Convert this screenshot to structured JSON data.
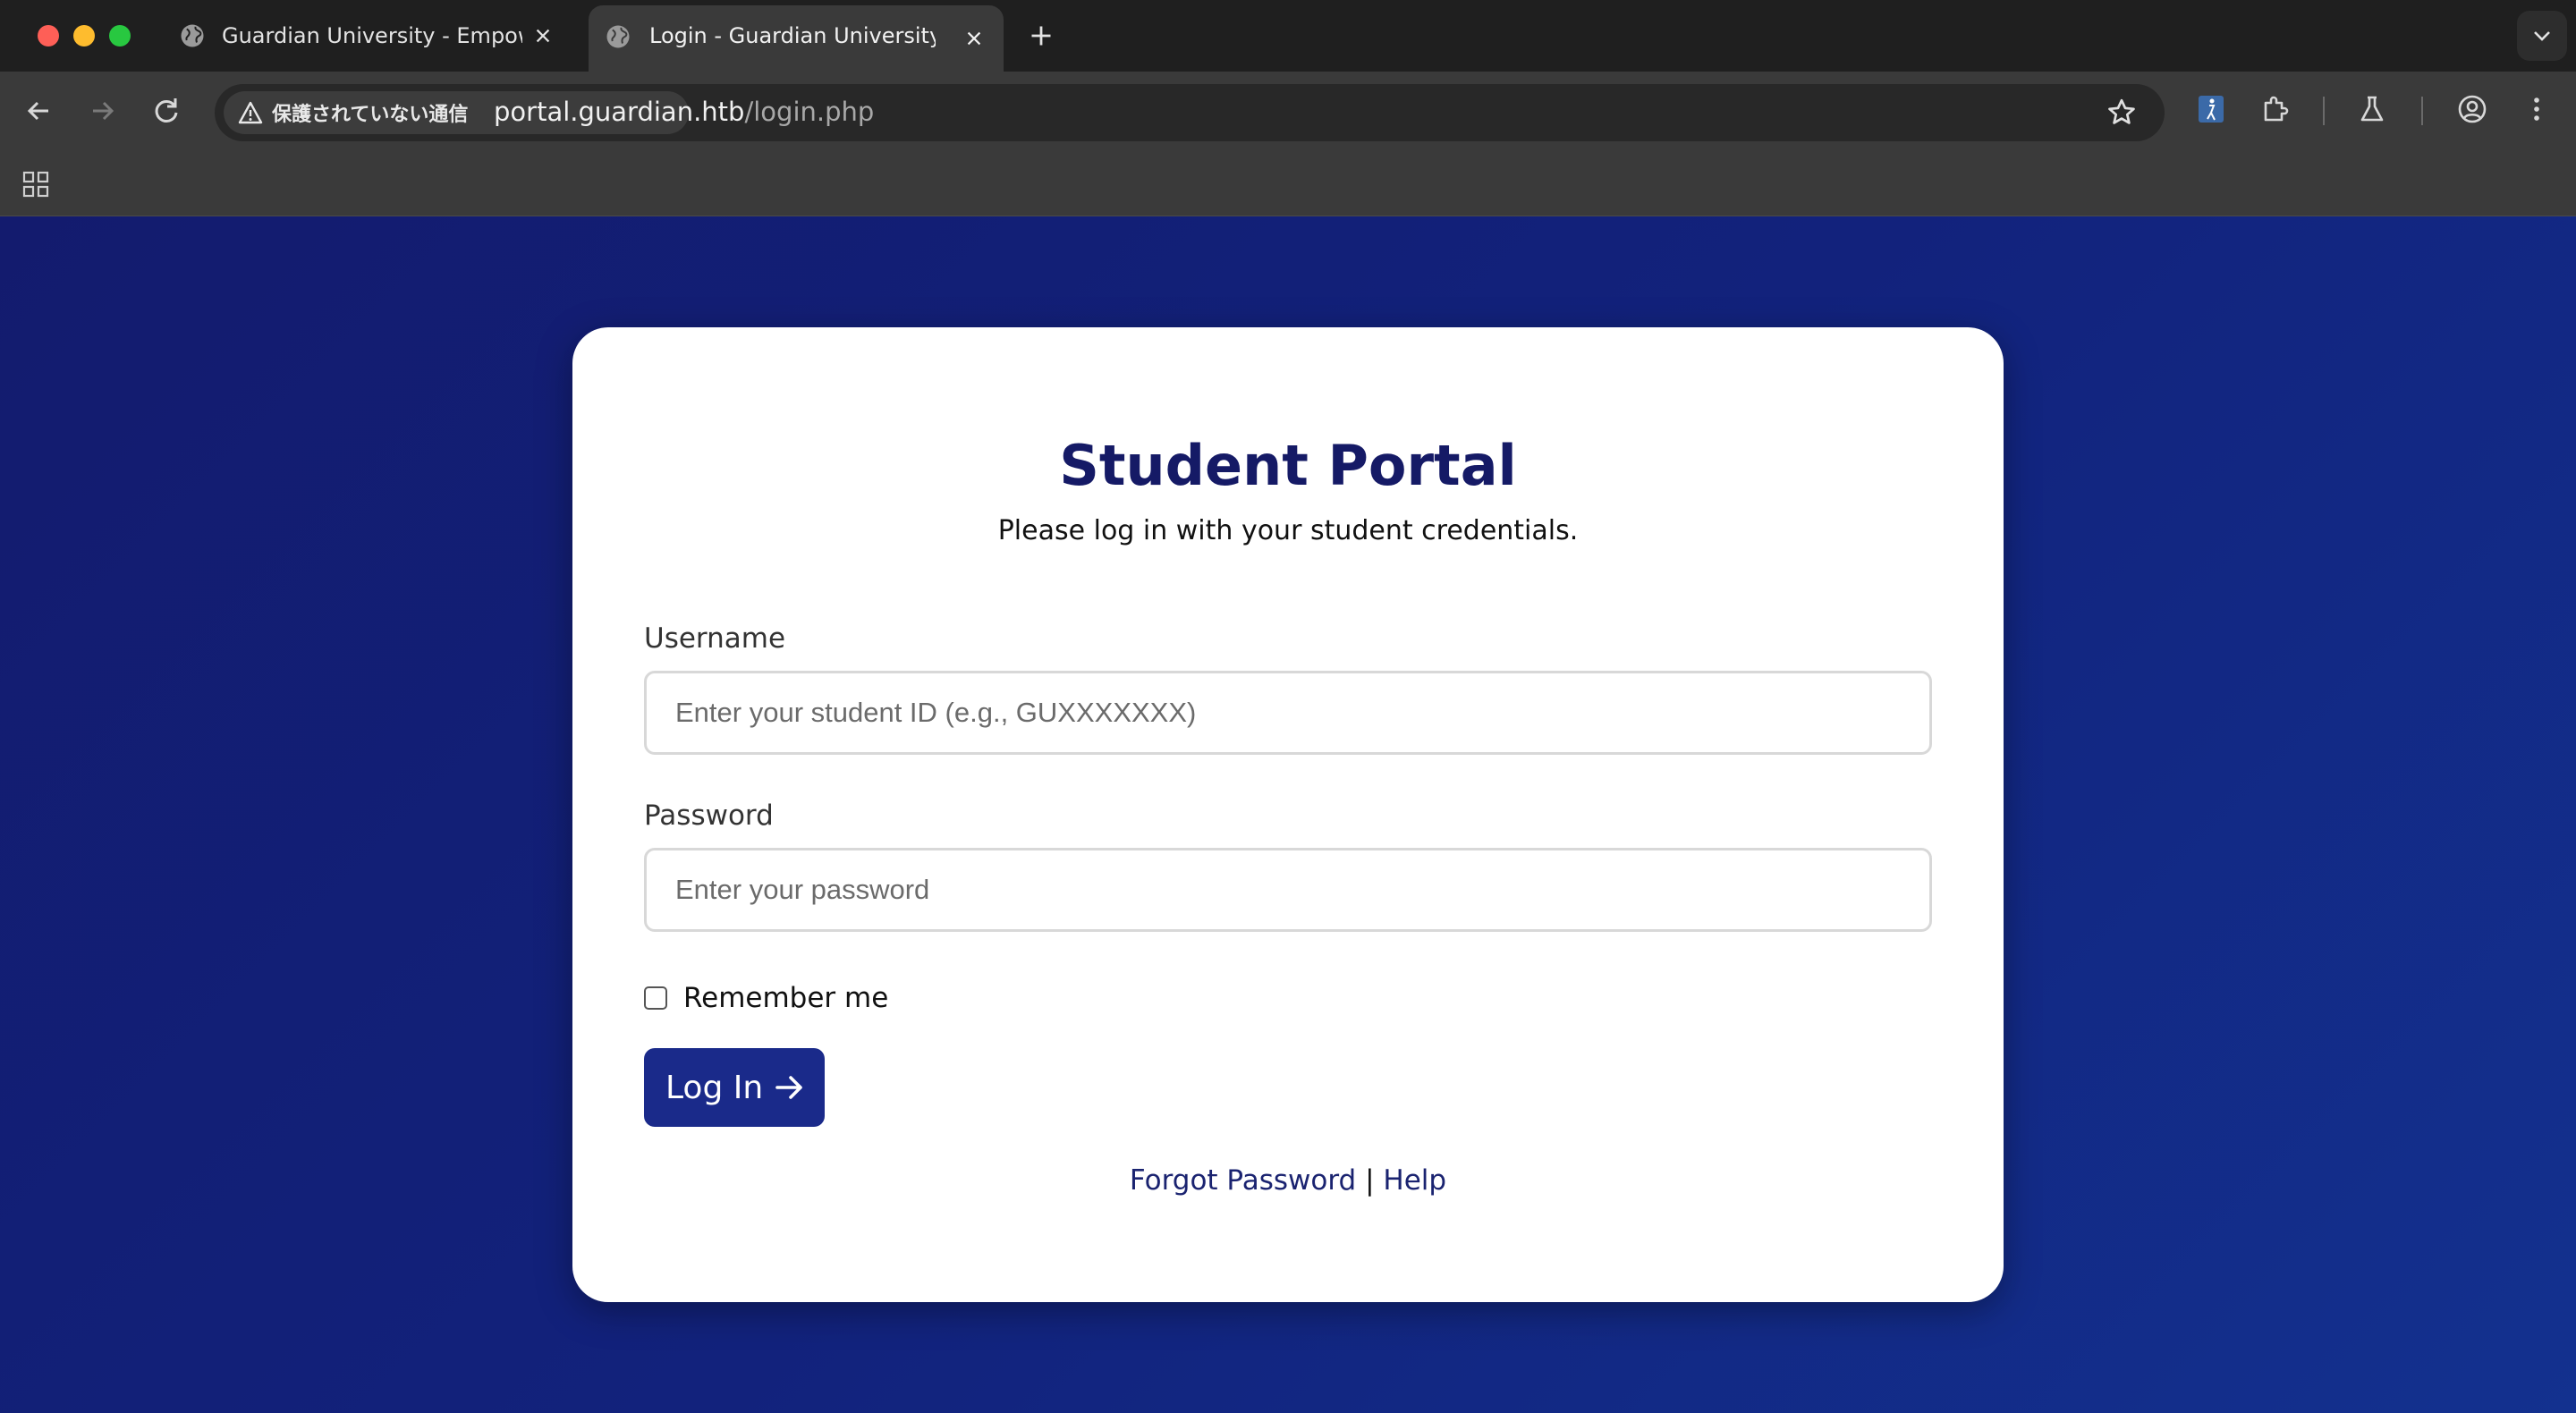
{
  "browser": {
    "tabs": [
      {
        "title": "Guardian University - Empowering",
        "active": false
      },
      {
        "title": "Login - Guardian University",
        "active": true
      }
    ],
    "omnibox": {
      "security_label": "保護されていない通信",
      "url_host": "portal.guardian.htb",
      "url_path": "/login.php"
    }
  },
  "colors": {
    "page_bg_start": "#131b6e",
    "page_bg_end": "#13318f",
    "title": "#151a66",
    "button": "#1a2a8a"
  },
  "login": {
    "title": "Student Portal",
    "subtitle": "Please log in with your student credentials.",
    "username_label": "Username",
    "username_placeholder": "Enter your student ID (e.g., GUXXXXXXX)",
    "username_value": "",
    "password_label": "Password",
    "password_placeholder": "Enter your password",
    "password_value": "",
    "remember_label": "Remember me",
    "remember_checked": false,
    "submit_label": "Log In",
    "forgot_label": "Forgot Password",
    "link_separator": "|",
    "help_label": "Help"
  }
}
